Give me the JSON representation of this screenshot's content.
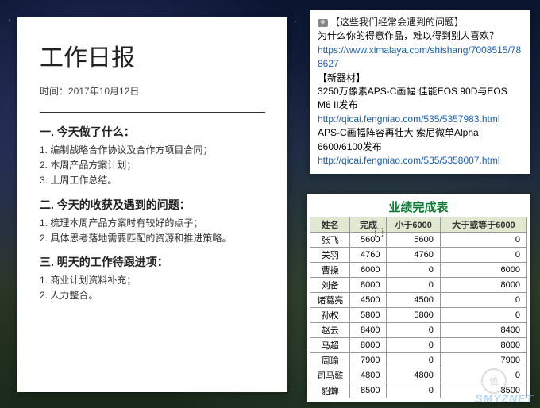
{
  "report": {
    "title": "工作日报",
    "date_label": "时间：2017年10月12日",
    "sections": [
      {
        "title": "一. 今天做了什么：",
        "lines": [
          "1. 编制战略合作协议及合作方项目合同；",
          "2. 本周产品方案计划；",
          "3. 上周工作总结。"
        ]
      },
      {
        "title": "二. 今天的收获及遇到的问题：",
        "lines": [
          "1. 梳理本周产品方案时有较好的点子；",
          "2. 具体思考落地需要匹配的资源和推进策略。"
        ]
      },
      {
        "title": "三. 明天的工作待跟进项：",
        "lines": [
          "1. 商业计划资料补充；",
          "2. 人力整合。"
        ]
      }
    ]
  },
  "note": {
    "header": "【这些我们经常会遇到的问题】",
    "q": "为什么你的得意作品，难以得到别人喜欢？",
    "link1": "https://www.ximalaya.com/shishang/7008515/788627",
    "sec2": "【新器材】",
    "p2": "3250万像素APS-C画幅 佳能EOS 90D与EOS M6 II发布",
    "link2": "http://qicai.fengniao.com/535/5357983.html",
    "p3": "APS-C画幅阵容再壮大 索尼微单Alpha 6600/6100发布",
    "link3": "http://qicai.fengniao.com/535/5358007.html"
  },
  "chart_data": {
    "type": "table",
    "title": "业绩完成表",
    "columns": [
      "姓名",
      "完成",
      "小于6000",
      "大于或等于6000"
    ],
    "rows": [
      [
        "张飞",
        5600,
        5600,
        0
      ],
      [
        "关羽",
        4760,
        4760,
        0
      ],
      [
        "曹操",
        6000,
        0,
        6000
      ],
      [
        "刘备",
        8000,
        0,
        8000
      ],
      [
        "诸葛亮",
        4500,
        4500,
        0
      ],
      [
        "孙权",
        5800,
        5800,
        0
      ],
      [
        "赵云",
        8400,
        0,
        8400
      ],
      [
        "马超",
        8000,
        0,
        8000
      ],
      [
        "周瑜",
        7900,
        0,
        7900
      ],
      [
        "司马懿",
        4800,
        4800,
        0
      ],
      [
        "貂蝉",
        8500,
        0,
        8500
      ]
    ]
  },
  "watermark": "SMYZNET",
  "badge": "值"
}
